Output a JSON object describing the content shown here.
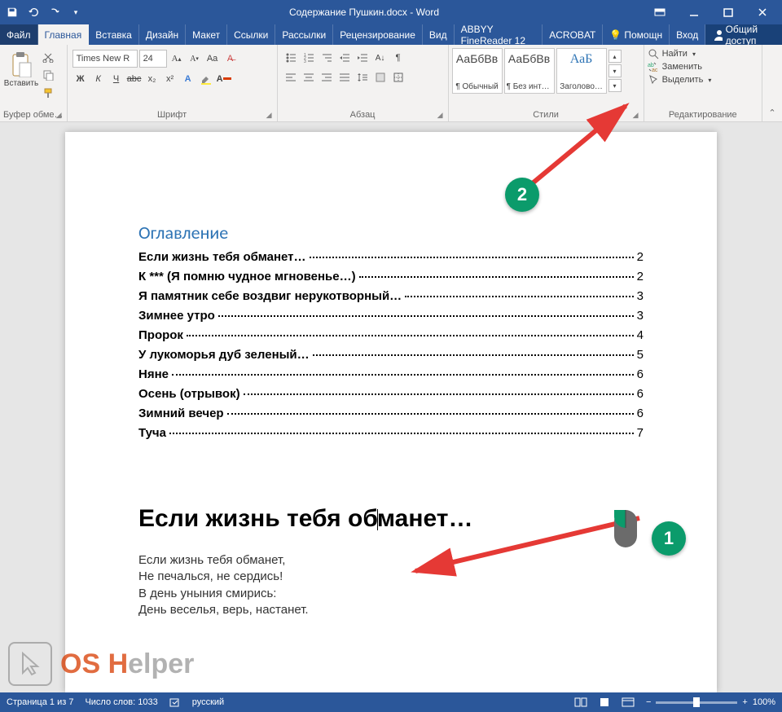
{
  "title": "Содержание Пушкин.docx - Word",
  "tabs": {
    "file": "Файл",
    "home": "Главная",
    "insert": "Вставка",
    "design": "Дизайн",
    "layout": "Макет",
    "references": "Ссылки",
    "mailings": "Рассылки",
    "review": "Рецензирование",
    "view": "Вид",
    "abbyy": "ABBYY FineReader 12",
    "acrobat": "ACROBAT",
    "help": "Помощн",
    "login": "Вход",
    "share": "Общий доступ"
  },
  "clipboard": {
    "paste": "Вставить",
    "group": "Буфер обме…"
  },
  "font": {
    "name": "Times New R",
    "size": "24",
    "group": "Шрифт",
    "bold": "Ж",
    "italic": "К",
    "underline": "Ч",
    "strike": "abc",
    "sub": "x₂",
    "sup": "x²"
  },
  "paragraph": {
    "group": "Абзац"
  },
  "styles": {
    "group": "Стили",
    "s1": "¶ Обычный",
    "s2": "¶ Без инте…",
    "s3": "Заголово…",
    "preview": "АаБбВв",
    "preview3": "АаБ"
  },
  "editing": {
    "group": "Редактирование",
    "find": "Найти",
    "replace": "Заменить",
    "select": "Выделить"
  },
  "doc": {
    "toc_title": "Оглавление",
    "items": [
      {
        "t": "Если жизнь тебя обманет…",
        "p": "2"
      },
      {
        "t": "К *** (Я помню чудное мгновенье…)",
        "p": "2"
      },
      {
        "t": "Я памятник себе воздвиг нерукотворный…",
        "p": "3"
      },
      {
        "t": "Зимнее утро",
        "p": "3"
      },
      {
        "t": "Пророк",
        "p": "4"
      },
      {
        "t": "У лукоморья дуб зеленый…",
        "p": "5"
      },
      {
        "t": "Няне",
        "p": "6"
      },
      {
        "t": "Осень (отрывок)",
        "p": "6"
      },
      {
        "t": "Зимний вечер",
        "p": "6"
      },
      {
        "t": "Туча",
        "p": "7"
      }
    ],
    "h1a": "Если жизнь тебя об",
    "h1b": "манет…",
    "body": "Если жизнь тебя обманет,\nНе печалься, не сердись!\nВ день уныния смирись:\nДень веселья, верь, настанет."
  },
  "status": {
    "page": "Страница 1 из 7",
    "words": "Число слов: 1033",
    "lang": "русский",
    "zoom": "100%"
  },
  "callouts": {
    "c1": "1",
    "c2": "2"
  },
  "watermark": {
    "a": "OS H",
    "b": "elper"
  }
}
